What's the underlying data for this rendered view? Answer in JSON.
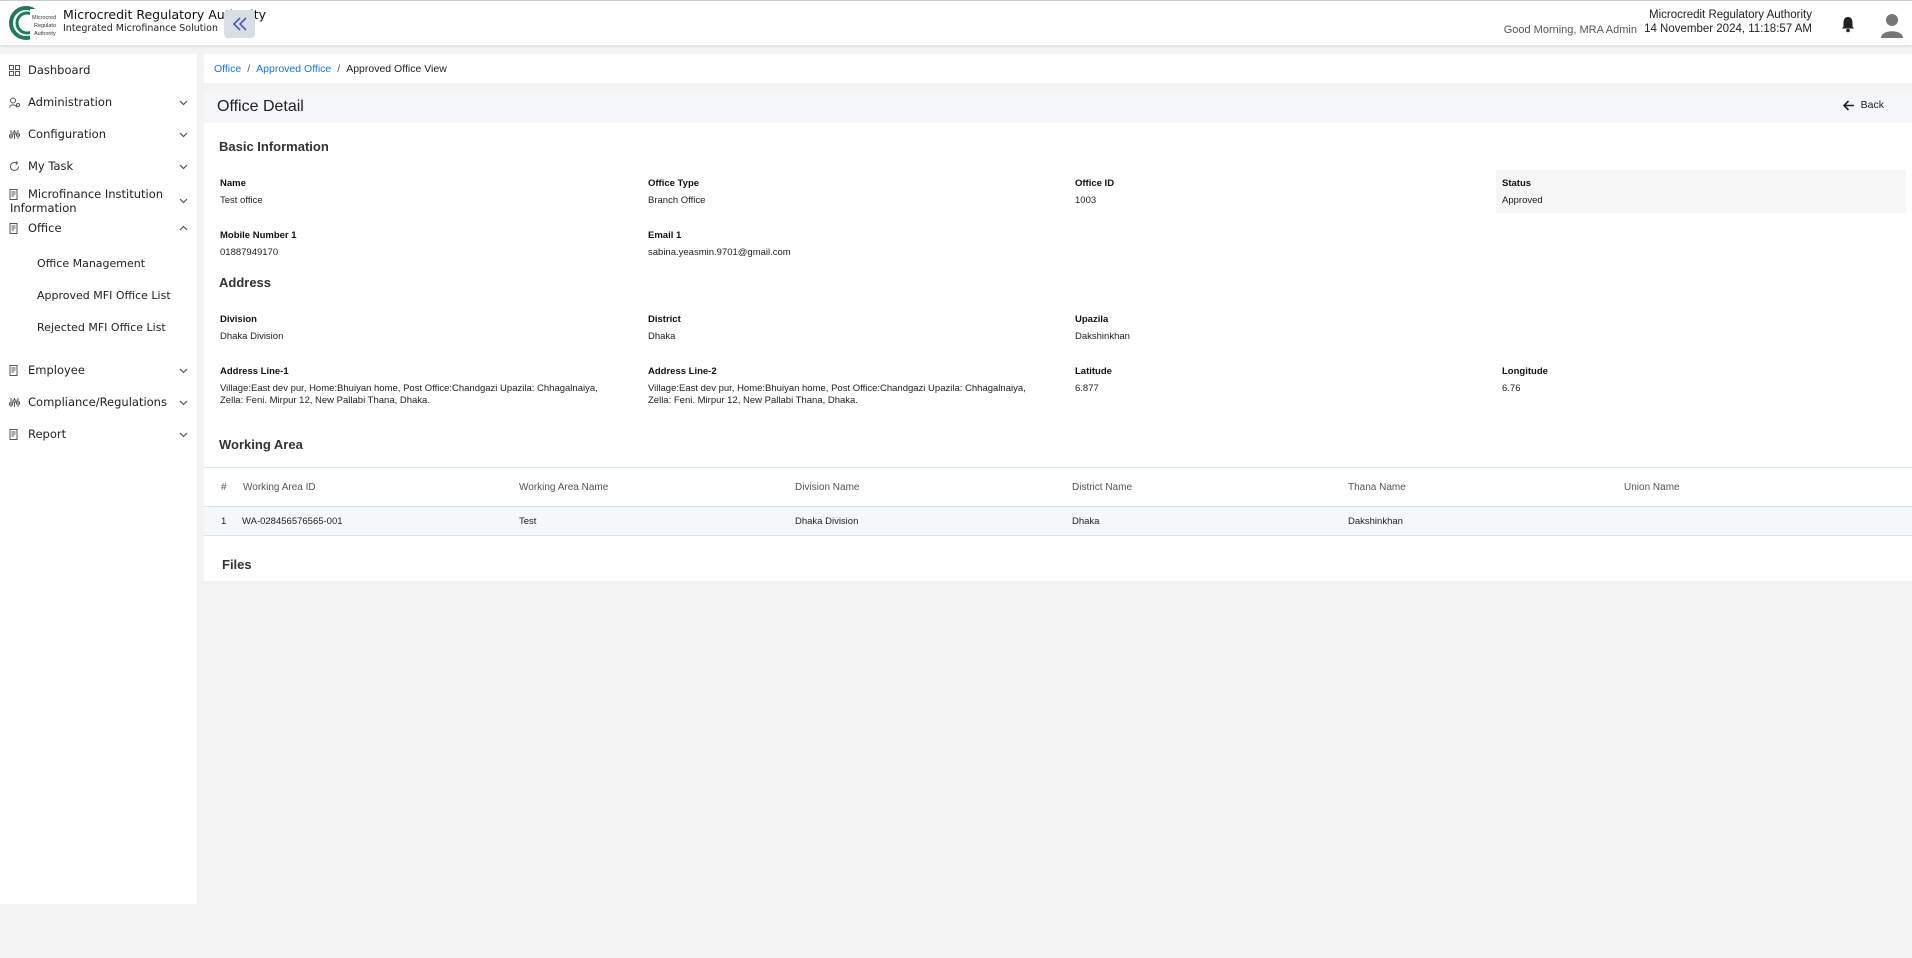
{
  "header": {
    "brand_title": "Microcredit Regulatory Authority",
    "brand_sub": "Integrated Microfinance Solution",
    "logo_text": "Microcredit Regulatory Authority",
    "greeting": "Good Morning, MRA Admin",
    "org_name": "Microcredit Regulatory Authority",
    "datetime": "14 November 2024, 11:18:57 AM",
    "accent": "#1a73e8"
  },
  "sidebar": {
    "items": [
      {
        "label": "Dashboard",
        "icon": "grid-icon"
      },
      {
        "label": "Administration",
        "icon": "user-gear-icon"
      },
      {
        "label": "Configuration",
        "icon": "sliders-icon"
      },
      {
        "label": "My Task",
        "icon": "refresh-icon"
      },
      {
        "label": "Microfinance Institution",
        "label2": "Information",
        "icon": "document-icon"
      },
      {
        "label": "Office",
        "icon": "document-icon"
      },
      {
        "label": "Employee",
        "icon": "document-icon"
      },
      {
        "label": "Compliance/Regulations",
        "icon": "sliders-icon"
      },
      {
        "label": "Report",
        "icon": "document-icon"
      }
    ],
    "office_sub": [
      "Office Management",
      "Approved MFI Office List",
      "Rejected MFI Office List"
    ]
  },
  "breadcrumb": {
    "items": [
      "Office",
      "Approved Office"
    ],
    "current": "Approved Office View"
  },
  "page": {
    "title": "Office Detail",
    "back_label": "Back"
  },
  "basic": {
    "title": "Basic Information",
    "name_label": "Name",
    "name": "Test office",
    "type_label": "Office Type",
    "type": "Branch Office",
    "id_label": "Office ID",
    "id": "1003",
    "status_label": "Status",
    "status": "Approved",
    "mobile_label": "Mobile Number 1",
    "mobile": "01887949170",
    "email_label": "Email 1",
    "email": "sabina.yeasmin.9701@gmail.com"
  },
  "address": {
    "title": "Address",
    "division_label": "Division",
    "division": "Dhaka Division",
    "district_label": "District",
    "district": "Dhaka",
    "upazila_label": "Upazila",
    "upazila": "Dakshinkhan",
    "line1_label": "Address Line-1",
    "line1": "Village:East dev pur, Home:Bhuiyan home, Post Office:Chandgazi Upazila: Chhagalnaiya, Zella: Feni. Mirpur 12, New Pallabi Thana, Dhaka.",
    "line2_label": "Address Line-2",
    "line2": "Village:East dev pur, Home:Bhuiyan home, Post Office:Chandgazi Upazila: Chhagalnaiya, Zella: Feni. Mirpur 12, New Pallabi Thana, Dhaka.",
    "lat_label": "Latitude",
    "lat": "6.877",
    "lng_label": "Longitude",
    "lng": "6.76"
  },
  "working_area": {
    "title": "Working Area",
    "columns": [
      "#",
      "Working Area ID",
      "Working Area Name",
      "Division Name",
      "District Name",
      "Thana Name",
      "Union Name"
    ],
    "rows": [
      [
        "1",
        "WA-028456576565-001",
        "Test",
        "Dhaka Division",
        "Dhaka",
        "Dakshinkhan",
        ""
      ]
    ]
  },
  "files": {
    "title": "Files"
  }
}
